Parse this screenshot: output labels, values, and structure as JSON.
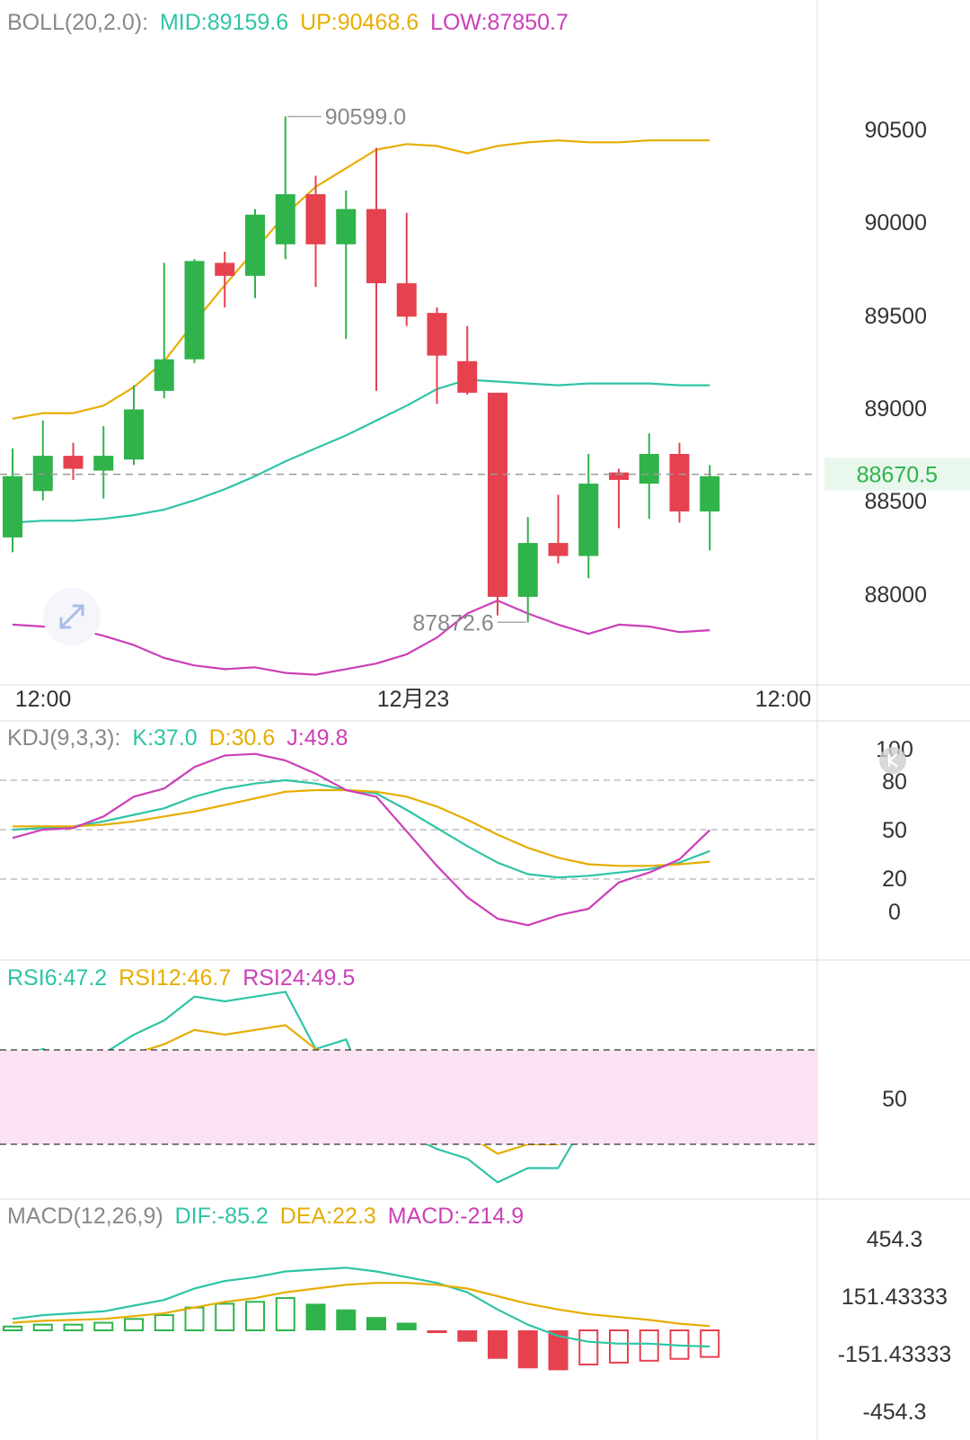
{
  "colors": {
    "up": "#2fb34a",
    "down": "#e5414f",
    "mid": "#2ec4a6",
    "upper": "#e6ad00",
    "lower": "#cc3fb8",
    "k": "#2ec4a6",
    "d": "#e6ad00",
    "j": "#cc3fb8",
    "rsi6": "#2ec4a6",
    "rsi12": "#e6ad00",
    "rsi24": "#cc3fb8",
    "dif": "#2ec4a6",
    "dea": "#e6ad00",
    "macd": "#cc3fb8",
    "axis_text": "#333333",
    "muted": "#999999",
    "rsi_band": "#fbe3f3"
  },
  "boll_header": {
    "name": "BOLL(20,2.0):",
    "mid": "MID:89159.6",
    "up": "UP:90468.6",
    "low": "LOW:87850.7"
  },
  "kdj_header": {
    "name": "KDJ(9,3,3):",
    "k": "K:37.0",
    "d": "D:30.6",
    "j": "J:49.8"
  },
  "rsi_header": {
    "r6": "RSI6:47.2",
    "r12": "RSI12:46.7",
    "r24": "RSI24:49.5"
  },
  "macd_header": {
    "name": "MACD(12,26,9)",
    "dif": "DIF:-85.2",
    "dea": "DEA:22.3",
    "macd": "MACD:-214.9"
  },
  "price_labels": {
    "max": "90599.0",
    "min": "87872.6",
    "current": "88670.5",
    "y_ticks": [
      "90500",
      "90000",
      "89500",
      "89000",
      "88500",
      "88000"
    ]
  },
  "time_axis": [
    "12:00",
    "12月23",
    "12:00"
  ],
  "kdj_ticks": [
    "100",
    "80",
    "50",
    "20",
    "0"
  ],
  "rsi_ticks": [
    "50"
  ],
  "macd_ticks": [
    "454.3",
    "151.43333",
    "-151.43333",
    "-454.3"
  ],
  "chart_data": [
    {
      "type": "candlestick",
      "overlay": "BOLL(20,2.0)",
      "current_price": 88670.5,
      "ylim": [
        87560,
        90880
      ],
      "candles": [
        {
          "o": 88330,
          "h": 88810,
          "l": 88250,
          "c": 88660
        },
        {
          "o": 88580,
          "h": 88960,
          "l": 88530,
          "c": 88770
        },
        {
          "o": 88770,
          "h": 88840,
          "l": 88640,
          "c": 88700
        },
        {
          "o": 88690,
          "h": 88930,
          "l": 88540,
          "c": 88770
        },
        {
          "o": 88750,
          "h": 89150,
          "l": 88720,
          "c": 89020
        },
        {
          "o": 89120,
          "h": 89810,
          "l": 89080,
          "c": 89290
        },
        {
          "o": 89290,
          "h": 89830,
          "l": 89270,
          "c": 89820
        },
        {
          "o": 89810,
          "h": 89870,
          "l": 89570,
          "c": 89740
        },
        {
          "o": 89740,
          "h": 90100,
          "l": 89620,
          "c": 90070
        },
        {
          "o": 89910,
          "h": 90599,
          "l": 89830,
          "c": 90180
        },
        {
          "o": 90180,
          "h": 90280,
          "l": 89680,
          "c": 89910
        },
        {
          "o": 89910,
          "h": 90200,
          "l": 89400,
          "c": 90100
        },
        {
          "o": 90100,
          "h": 90430,
          "l": 89120,
          "c": 89700
        },
        {
          "o": 89700,
          "h": 90080,
          "l": 89470,
          "c": 89520
        },
        {
          "o": 89540,
          "h": 89570,
          "l": 89050,
          "c": 89310
        },
        {
          "o": 89280,
          "h": 89470,
          "l": 89100,
          "c": 89110
        },
        {
          "o": 89110,
          "h": 89110,
          "l": 87910,
          "c": 88010
        },
        {
          "o": 88010,
          "h": 88440,
          "l": 87872.6,
          "c": 88300
        },
        {
          "o": 88300,
          "h": 88560,
          "l": 88190,
          "c": 88230
        },
        {
          "o": 88230,
          "h": 88780,
          "l": 88110,
          "c": 88620
        },
        {
          "o": 88680,
          "h": 88700,
          "l": 88380,
          "c": 88640
        },
        {
          "o": 88620,
          "h": 88890,
          "l": 88430,
          "c": 88780
        },
        {
          "o": 88780,
          "h": 88840,
          "l": 88410,
          "c": 88470
        },
        {
          "o": 88470,
          "h": 88720,
          "l": 88260,
          "c": 88660
        }
      ],
      "boll_mid": [
        88410,
        88420,
        88420,
        88430,
        88450,
        88480,
        88530,
        88590,
        88660,
        88740,
        88810,
        88880,
        88960,
        89040,
        89130,
        89180,
        89170,
        89160,
        89150,
        89160,
        89160,
        89160,
        89150,
        89150
      ],
      "boll_up": [
        88970,
        89000,
        89000,
        89040,
        89140,
        89280,
        89490,
        89690,
        89880,
        90070,
        90220,
        90320,
        90420,
        90450,
        90440,
        90400,
        90440,
        90460,
        90470,
        90460,
        90460,
        90470,
        90470,
        90470
      ],
      "boll_low": [
        87860,
        87850,
        87840,
        87800,
        87750,
        87680,
        87640,
        87620,
        87630,
        87600,
        87590,
        87620,
        87650,
        87700,
        87790,
        87920,
        87990,
        87920,
        87860,
        87810,
        87860,
        87850,
        87820,
        87830
      ]
    },
    {
      "type": "line",
      "name": "KDJ(9,3,3)",
      "ylim": [
        0,
        100
      ],
      "series": [
        {
          "name": "K",
          "values": [
            50,
            51,
            52,
            55,
            59,
            63,
            70,
            75,
            78,
            80,
            78,
            74,
            72,
            62,
            51,
            40,
            30,
            23,
            21,
            22,
            24,
            26,
            30,
            37
          ]
        },
        {
          "name": "D",
          "values": [
            52,
            52,
            52,
            53,
            55,
            58,
            61,
            65,
            69,
            73,
            74,
            74,
            73,
            70,
            64,
            56,
            47,
            39,
            33,
            29,
            28,
            28,
            29,
            30.6
          ]
        },
        {
          "name": "J",
          "values": [
            45,
            50,
            51,
            58,
            70,
            75,
            88,
            95,
            96,
            92,
            84,
            74,
            70,
            49,
            28,
            9,
            -4,
            -8,
            -2,
            2,
            18,
            24,
            32,
            49.8
          ]
        }
      ]
    },
    {
      "type": "line",
      "name": "RSI",
      "ylim": [
        30,
        70
      ],
      "series": [
        {
          "name": "RSI6",
          "values": [
            58,
            60,
            57,
            59,
            63,
            66,
            71,
            70,
            71,
            72,
            60,
            62,
            47,
            42,
            39,
            37,
            32,
            35,
            35,
            46,
            46,
            48,
            45,
            47.2
          ]
        },
        {
          "name": "RSI12",
          "values": [
            55,
            57,
            56,
            57,
            59,
            61,
            64,
            63,
            64,
            65,
            60,
            58,
            51,
            47,
            44,
            42,
            38,
            40,
            40,
            45,
            45,
            47,
            46,
            46.7
          ]
        },
        {
          "name": "RSI24",
          "values": [
            54,
            55,
            54,
            54,
            56,
            57,
            58,
            58,
            58,
            59,
            57,
            57,
            52,
            51,
            50,
            49,
            45,
            47,
            47,
            50,
            50,
            50,
            49,
            49.5
          ]
        }
      ]
    },
    {
      "type": "bar",
      "name": "MACD(12,26,9)",
      "ylim": [
        -454.3,
        454.3
      ],
      "histogram": [
        20,
        30,
        30,
        40,
        60,
        80,
        120,
        140,
        150,
        170,
        140,
        110,
        70,
        40,
        -10,
        -60,
        -150,
        -200,
        -210,
        -180,
        -170,
        -160,
        -150,
        -140
      ],
      "series": [
        {
          "name": "DIF",
          "values": [
            60,
            80,
            90,
            100,
            130,
            160,
            220,
            260,
            280,
            310,
            320,
            330,
            310,
            280,
            250,
            200,
            110,
            30,
            -30,
            -60,
            -70,
            -70,
            -80,
            -85.2
          ]
        },
        {
          "name": "DEA",
          "values": [
            40,
            50,
            55,
            60,
            75,
            90,
            120,
            150,
            170,
            200,
            220,
            240,
            250,
            250,
            240,
            220,
            180,
            140,
            110,
            85,
            70,
            55,
            35,
            22.3
          ]
        }
      ]
    }
  ]
}
